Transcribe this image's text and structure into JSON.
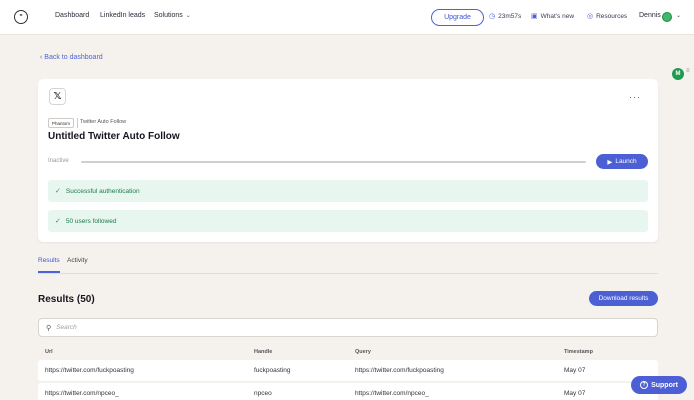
{
  "nav": {
    "links": [
      "Dashboard",
      "LinkedIn leads",
      "Solutions"
    ],
    "upgrade_label": "Upgrade",
    "timer": "23m57s",
    "whats_new": "What's new",
    "resources": "Resources",
    "user_name": "Dennis"
  },
  "back_link": "Back to dashboard",
  "phantom": {
    "badge": "Phantom",
    "type": "Twitter Auto Follow",
    "title": "Untitled Twitter Auto Follow",
    "status": "Inactive",
    "launch_label": "Launch",
    "alerts": [
      "Successful authentication",
      "50 users followed"
    ]
  },
  "tabs": [
    "Results",
    "Activity"
  ],
  "results": {
    "title": "Results (50)",
    "download_label": "Download results",
    "search_placeholder": "Search",
    "columns": [
      "Url",
      "Handle",
      "Query",
      "Timestamp"
    ],
    "rows": [
      [
        "https://twitter.com/fuckpoasting",
        "fuckpoasting",
        "https://twitter.com/fuckpoasting",
        "May 07"
      ],
      [
        "https://twitter.com/npceo_",
        "npceo",
        "https://twitter.com/npceo_",
        "May 07"
      ]
    ]
  },
  "support_label": "Support",
  "extension_label": "M",
  "colors": {
    "accent": "#4c5fd5",
    "success_bg": "#e7f6ef",
    "success_text": "#1f7a4b",
    "background": "#f5f2ee"
  }
}
